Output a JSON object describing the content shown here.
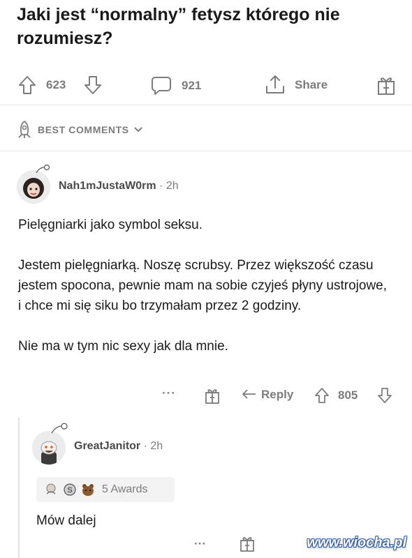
{
  "post": {
    "title": "Jaki jest “normalny” fetysz którego nie rozumiesz?",
    "upvotes": "623",
    "comments": "921",
    "share_label": "Share"
  },
  "sort": {
    "label": "BEST COMMENTS"
  },
  "comment1": {
    "username": "Nah1mJustaW0rm",
    "dot": "·",
    "time": "2h",
    "text": "Pielęgniarki jako symbol seksu.\n\nJestem pielęgniarką. Noszę scrubsy. Przez większość czasu jestem spocona, pewnie mam na sobie czyjeś płyny ustrojowe, i chce mi się siku bo trzymałam przez 2 godziny.\n\nNie ma w tym nic sexy jak dla mnie.",
    "more": "···",
    "reply_label": "Reply",
    "score": "805"
  },
  "comment2": {
    "username": "GreatJanitor",
    "dot": "·",
    "time": "2h",
    "awards_label": "5 Awards",
    "text": "Mów dalej",
    "more": "···"
  },
  "watermark": "www.wiocha.pl",
  "colors": {
    "text": "#1a1a1b",
    "meta": "#7c7c7c",
    "divider": "#e6e6e6"
  }
}
